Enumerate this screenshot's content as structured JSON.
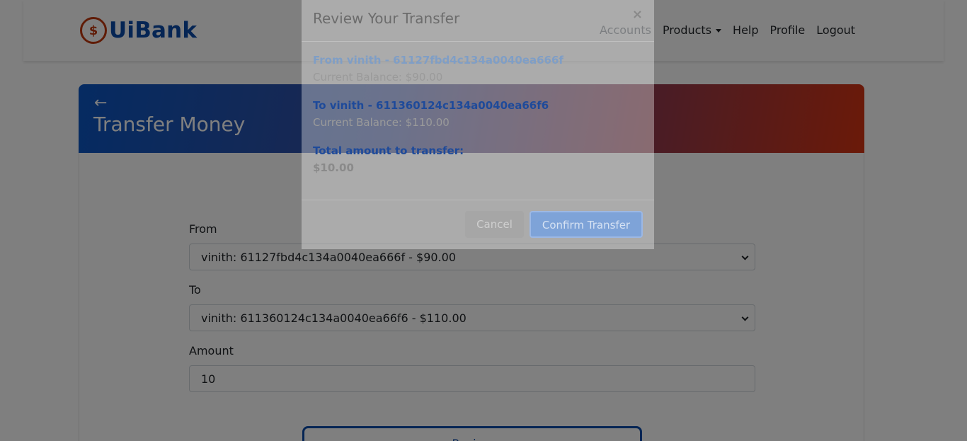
{
  "brand": {
    "logo_symbol": "$",
    "name": "UiBank"
  },
  "nav": {
    "accounts": "Accounts",
    "products": "Products",
    "help": "Help",
    "profile": "Profile",
    "logout": "Logout"
  },
  "page": {
    "back_icon": "←",
    "title": "Transfer Money"
  },
  "form": {
    "from_label": "From",
    "from_value": "vinith: 61127fbd4c134a0040ea666f - $90.00",
    "to_label": "To",
    "to_value": "vinith: 611360124c134a0040ea66f6 - $110.00",
    "amount_label": "Amount",
    "amount_value": "10",
    "review_label": "Review"
  },
  "modal": {
    "title": "Review Your Transfer",
    "close": "×",
    "from_line": "From vinith - 61127fbd4c134a0040ea666f",
    "from_balance": "Current Balance: $90.00",
    "to_line": "To vinith - 611360124c134a0040ea66f6",
    "to_balance": "Current Balance: $110.00",
    "total_label": "Total amount to transfer:",
    "total_value": "$10.00",
    "cancel_label": "Cancel",
    "confirm_label": "Confirm Transfer"
  },
  "colors": {
    "brand_blue": "#0b4aa8",
    "brand_orange": "#c0390f",
    "header_gradient_start": "#0b56c4",
    "header_gradient_end": "#d63412"
  }
}
